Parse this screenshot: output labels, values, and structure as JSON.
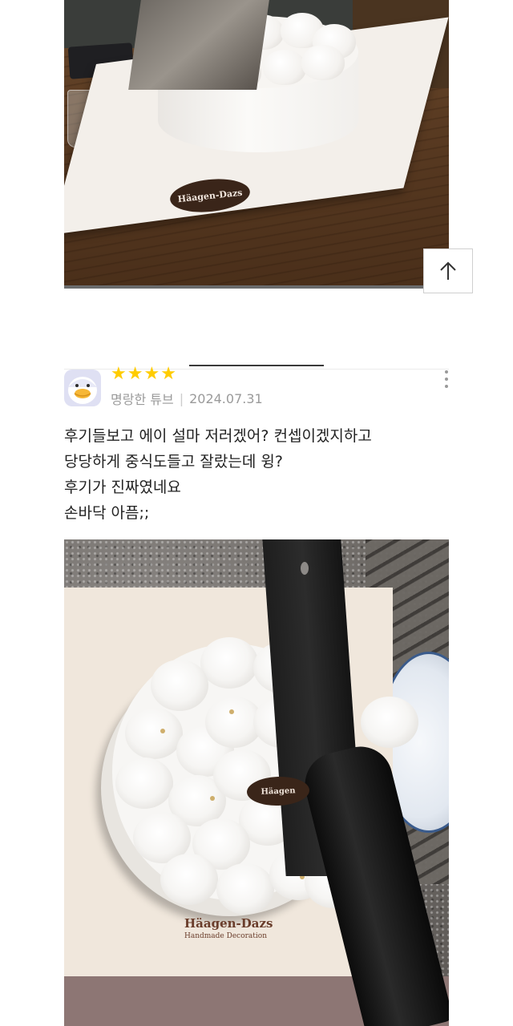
{
  "photo_top": {
    "logo_text": "Häagen-Dazs"
  },
  "scroll_top_button": {
    "icon": "arrow-up-icon"
  },
  "review": {
    "rating": 4,
    "max_rating": 5,
    "star_color": "#ffcc00",
    "reviewer_name": "명랑한 튜브",
    "date": "2024.07.31",
    "lines": [
      "후기들보고 에이 설마 저러겠어? 컨셉이겠지하고",
      "당당하게 중식도들고 잘랐는데 윙?",
      "후기가 진짜였네요",
      "손바닥 아픔;;"
    ]
  },
  "photo_bottom": {
    "logo_text": "Häagen",
    "brand_main": "Häagen-Dazs",
    "brand_sub": "Handmade Decoration"
  }
}
